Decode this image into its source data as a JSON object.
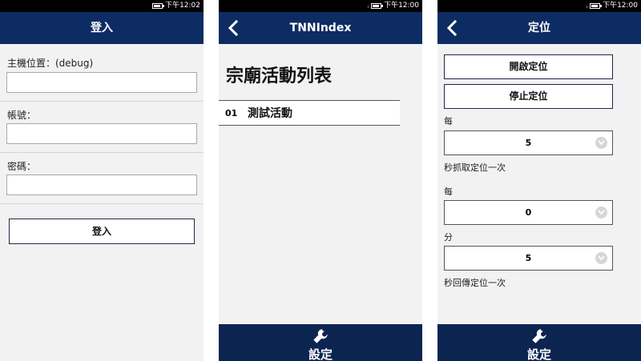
{
  "status_bar": {
    "time_1": "下午12:02",
    "time_2": "下午12:00",
    "time_3": "下午12:00"
  },
  "login_screen": {
    "title": "登入",
    "host_label": "主機位置：(debug)",
    "host_value": "",
    "account_label": "帳號：",
    "account_value": "",
    "password_label": "密碼：",
    "password_value": "",
    "login_button": "登入"
  },
  "index_screen": {
    "title": "TNNIndex",
    "list_title": "宗廟活動列表",
    "items": [
      {
        "number": "01",
        "name": "測試活動"
      }
    ],
    "bottom_label": "設定",
    "icons": {
      "back": "chevron-left-icon",
      "settings": "wrench-icon"
    }
  },
  "location_screen": {
    "title": "定位",
    "start_button": "開啟定位",
    "stop_button": "停止定位",
    "every_label_1": "每",
    "interval_seconds": "5",
    "fetch_suffix": "秒抓取定位一次",
    "every_label_2": "每",
    "minutes_value": "0",
    "minutes_label": "分",
    "seconds_value": "5",
    "upload_suffix": "秒回傳定位一次",
    "bottom_label": "設定"
  },
  "colors": {
    "navbar": "#0e2c64",
    "bottombar": "#0c2450",
    "background": "#f2f2f2"
  }
}
